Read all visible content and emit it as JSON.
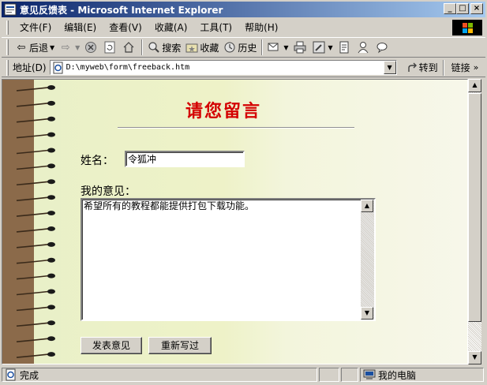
{
  "window": {
    "title": "意见反馈表 - Microsoft Internet Explorer",
    "buttons": {
      "minimize": "_",
      "maximize": "□",
      "close": "×"
    }
  },
  "menu": [
    "文件(F)",
    "编辑(E)",
    "查看(V)",
    "收藏(A)",
    "工具(T)",
    "帮助(H)"
  ],
  "toolbar": {
    "back": "后退",
    "search": "搜索",
    "favorites": "收藏",
    "history": "历史"
  },
  "address": {
    "label": "地址(D)",
    "url": "D:\\myweb\\form\\freeback.htm",
    "go": "转到",
    "links": "链接"
  },
  "page": {
    "heading": "请您留言",
    "name_label": "姓名：",
    "name_value": "令狐冲",
    "opinion_label": "我的意见：",
    "opinion_value": "希望所有的教程都能提供打包下载功能。",
    "submit_label": "发表意见",
    "reset_label": "重新写过"
  },
  "status": {
    "text": "完成",
    "zone": "我的电脑"
  },
  "colors": {
    "heading": "#d40000",
    "titlebar_start": "#0a246a",
    "titlebar_end": "#a6caf0"
  }
}
